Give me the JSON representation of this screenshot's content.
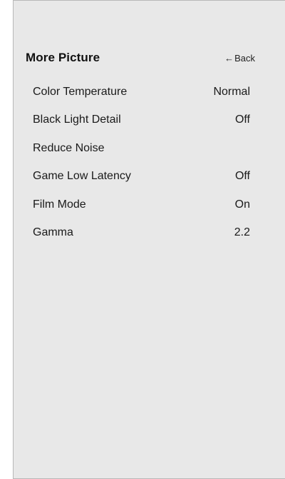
{
  "menu": {
    "title": "More Picture",
    "back_label": "Back",
    "back_arrow": "←",
    "items": [
      {
        "label": "Color Temperature",
        "value": "Normal"
      },
      {
        "label": "Black Light Detail",
        "value": "Off"
      },
      {
        "label": "Reduce Noise",
        "value": ""
      },
      {
        "label": "Game Low Latency",
        "value": "Off"
      },
      {
        "label": "Film Mode",
        "value": "On"
      },
      {
        "label": "Gamma",
        "value": "2.2"
      }
    ]
  },
  "colors": {
    "panel_background": "#e8e8e8",
    "panel_border": "#b8b8b8",
    "text": "#1a1a1a"
  }
}
